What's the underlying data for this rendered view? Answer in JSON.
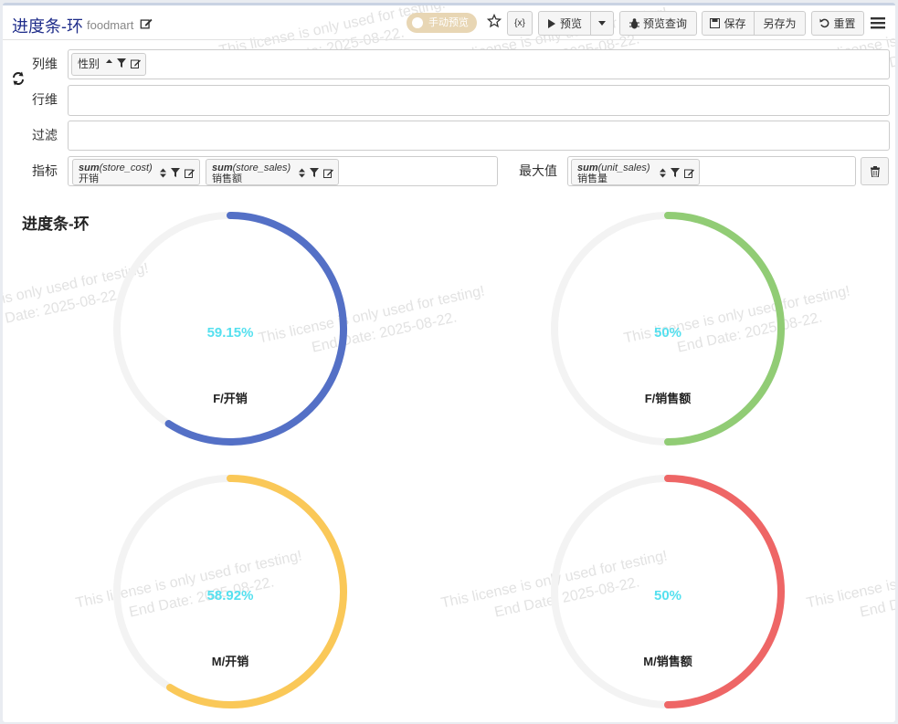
{
  "header": {
    "title": "进度条-环",
    "subtitle": "foodmart",
    "manual_preview_label": "手动预览",
    "var_label": "{x}",
    "preview_label": "预览",
    "preview_query_label": "预览查询",
    "save_label": "保存",
    "save_as_label": "另存为",
    "reset_label": "重置"
  },
  "config": {
    "columns_label": "列维",
    "rows_label": "行维",
    "filter_label": "过滤",
    "metrics_label": "指标",
    "max_label": "最大值",
    "column_pill": "性别",
    "metrics": [
      {
        "func": "sum",
        "field": "(store_cost)",
        "alias": "开销"
      },
      {
        "func": "sum",
        "field": "(store_sales)",
        "alias": "销售额"
      }
    ],
    "max": {
      "func": "sum",
      "field": "(unit_sales)",
      "alias": "销售量"
    }
  },
  "watermark": {
    "line1": "This license is only used for testing!",
    "line2": "End Date: 2025-08-22."
  },
  "chart_data": {
    "type": "progress-ring",
    "title": "进度条-环",
    "track_color": "#f3f3f3",
    "rings": [
      {
        "name": "F/开销",
        "value": 59.15,
        "label": "59.15%",
        "color": "#5470c6"
      },
      {
        "name": "F/销售额",
        "value": 50,
        "label": "50%",
        "color": "#91cc75"
      },
      {
        "name": "M/开销",
        "value": 58.92,
        "label": "58.92%",
        "color": "#fac858"
      },
      {
        "name": "M/销售额",
        "value": 50,
        "label": "50%",
        "color": "#ee6666"
      }
    ]
  }
}
